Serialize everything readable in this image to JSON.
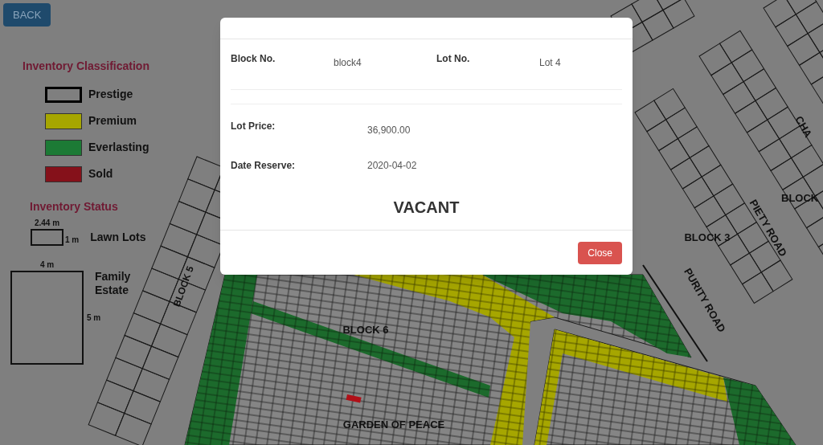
{
  "back_button": "BACK",
  "legend": {
    "classification_title": "Inventory Classification",
    "classes": [
      {
        "label": "Prestige",
        "color": "#7f7f7f"
      },
      {
        "label": "Premium",
        "color": "#a6a600"
      },
      {
        "label": "Everlasting",
        "color": "#1c7a35"
      },
      {
        "label": "Sold",
        "color": "#85111a"
      }
    ],
    "status_title": "Inventory Status",
    "lawn_lots": {
      "width": "2.44 m",
      "height": "1 m",
      "label": "Lawn Lots"
    },
    "family_estate": {
      "width": "4 m",
      "height": "5 m",
      "label": "Family Estate"
    }
  },
  "map": {
    "labels": [
      "BLOCK 5",
      "BLOCK 6",
      "GARDEN OF PEACE",
      "BLOCK 3",
      "BLOCK",
      "PIETY ROAD",
      "PURITY ROAD",
      "CHA"
    ]
  },
  "modal": {
    "fields": [
      {
        "label": "Block No.",
        "value": "block4"
      },
      {
        "label": "Lot No.",
        "value": "Lot 4"
      },
      {
        "label": "Lot Price:",
        "value": "36,900.00"
      },
      {
        "label": "Date Reserve:",
        "value": "2020-04-02"
      }
    ],
    "status": "VACANT",
    "close_button": "Close"
  }
}
